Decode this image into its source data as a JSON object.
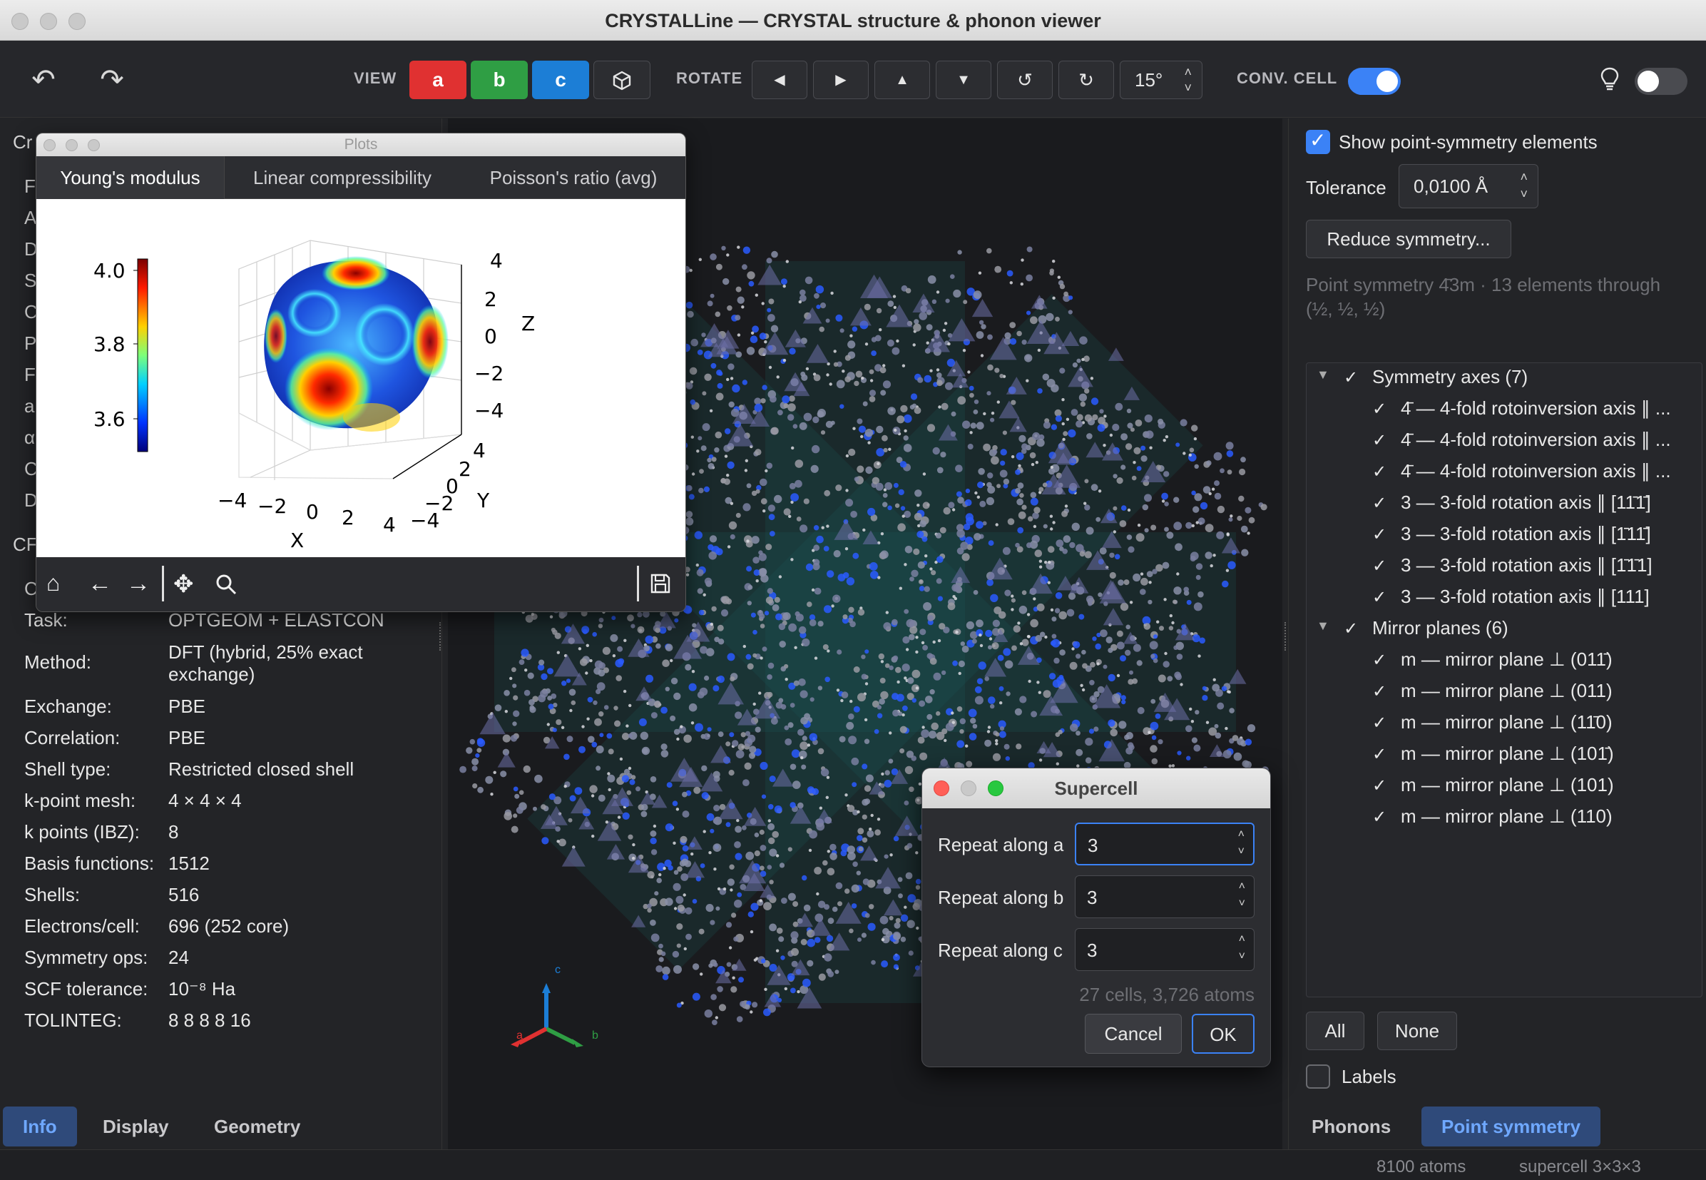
{
  "window": {
    "title": "CRYSTALLine — CRYSTAL structure & phonon viewer"
  },
  "toolbar": {
    "view_label": "VIEW",
    "view_buttons": [
      "a",
      "b",
      "c"
    ],
    "rotate_label": "ROTATE",
    "rotate_step": "15°",
    "conv_cell_label": "CONV. CELL"
  },
  "left_panel": {
    "stub_lines": [
      "Cr",
      "F",
      "A",
      "D",
      "S",
      "C",
      "P",
      "F",
      "a",
      "α",
      "C",
      "D"
    ],
    "stub_section": "CF",
    "stub_extra": "C",
    "info": [
      {
        "k": "Task:",
        "v": "OPTGEOM + ELASTCON"
      },
      {
        "k": "Method:",
        "v": "DFT (hybrid, 25% exact exchange)"
      },
      {
        "k": "Exchange:",
        "v": "PBE"
      },
      {
        "k": "Correlation:",
        "v": "PBE"
      },
      {
        "k": "Shell type:",
        "v": "Restricted closed shell"
      },
      {
        "k": "k-point mesh:",
        "v": "4 × 4 × 4"
      },
      {
        "k": "k points (IBZ):",
        "v": "8"
      },
      {
        "k": "Basis functions:",
        "v": "1512"
      },
      {
        "k": "Shells:",
        "v": "516"
      },
      {
        "k": "Electrons/cell:",
        "v": "696 (252 core)"
      },
      {
        "k": "Symmetry ops:",
        "v": "24"
      },
      {
        "k": "SCF tolerance:",
        "v": "10⁻⁸ Ha"
      },
      {
        "k": "TOLINTEG:",
        "v": "8 8 8 8 16"
      }
    ],
    "tabs": [
      "Info",
      "Display",
      "Geometry"
    ],
    "active_tab": "Info"
  },
  "plots": {
    "title": "Plots",
    "tabs": [
      "Young's modulus",
      "Linear compressibility",
      "Poisson's ratio (avg)"
    ],
    "active_tab": "Young's modulus",
    "colorbar_ticks": [
      "4.0",
      "3.8",
      "3.6"
    ],
    "z_ticks": [
      "4",
      "2",
      "0",
      "−2",
      "−4"
    ],
    "x_ticks": [
      "−4",
      "−2",
      "0",
      "2",
      "4"
    ],
    "y_ticks": [
      "4",
      "2",
      "0",
      "−2",
      "−4"
    ],
    "x_label": "X",
    "y_label": "Y",
    "z_label": "Z"
  },
  "viewport": {
    "axes": {
      "a": "a",
      "b": "b",
      "c": "c"
    }
  },
  "right_panel": {
    "show_symmetry_label": "Show point-symmetry elements",
    "tolerance_label": "Tolerance",
    "tolerance_value": "0,0100 Å",
    "reduce_button": "Reduce symmetry...",
    "summary": "Point symmetry 4̄3m · 13 elements through (½, ½, ½)",
    "groups": [
      {
        "label": "Symmetry axes (7)",
        "items": [
          "4̄ — 4-fold rotoinversion axis ∥ ...",
          "4̄ — 4-fold rotoinversion axis ∥ ...",
          "4̄ — 4-fold rotoinversion axis ∥ ...",
          "3 — 3-fold rotation axis ∥ [11̄1̄]",
          "3 — 3-fold rotation axis ∥ [1̄11̄]",
          "3 — 3-fold rotation axis ∥ [1̄1̄1]",
          "3 — 3-fold rotation axis ∥ [111]"
        ]
      },
      {
        "label": "Mirror planes (6)",
        "items": [
          "m — mirror plane ⊥ (011̄)",
          "m — mirror plane ⊥ (011)",
          "m — mirror plane ⊥ (11̄0)",
          "m — mirror plane ⊥ (101̄)",
          "m — mirror plane ⊥ (101)",
          "m — mirror plane ⊥ (110)"
        ]
      }
    ],
    "all_button": "All",
    "none_button": "None",
    "labels_label": "Labels",
    "tabs": [
      "Phonons",
      "Point symmetry"
    ],
    "active_tab": "Point symmetry"
  },
  "dialog": {
    "title": "Supercell",
    "rows": [
      {
        "label": "Repeat along a",
        "value": "3"
      },
      {
        "label": "Repeat along b",
        "value": "3"
      },
      {
        "label": "Repeat along c",
        "value": "3"
      }
    ],
    "summary": "27 cells, 3,726 atoms",
    "cancel": "Cancel",
    "ok": "OK"
  },
  "statusbar": {
    "atoms": "8100 atoms",
    "supercell": "supercell 3×3×3"
  },
  "colors": {
    "accent": "#3b82f6",
    "view_a": "#e03131",
    "view_b": "#2f9e44",
    "view_c": "#1c7ed6"
  }
}
